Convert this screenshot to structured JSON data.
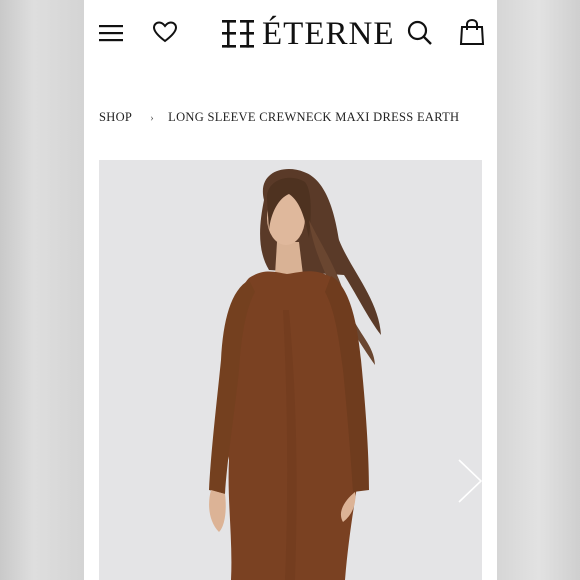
{
  "brand": {
    "name": "ÉTERNE"
  },
  "header": {
    "menu_icon": "hamburger-menu-icon",
    "wishlist_icon": "heart-icon",
    "search_icon": "search-icon",
    "bag_icon": "shopping-bag-icon"
  },
  "breadcrumb": {
    "items": [
      {
        "label": "SHOP"
      },
      {
        "label": "LONG SLEEVE CREWNECK MAXI DRESS EARTH"
      }
    ],
    "separator": "›"
  },
  "product": {
    "image_alt_icon": "model-photo",
    "dress_color": "#7a4122",
    "background_color": "#e5e5e5"
  },
  "carousel": {
    "next_icon": "chevron-right-icon"
  }
}
